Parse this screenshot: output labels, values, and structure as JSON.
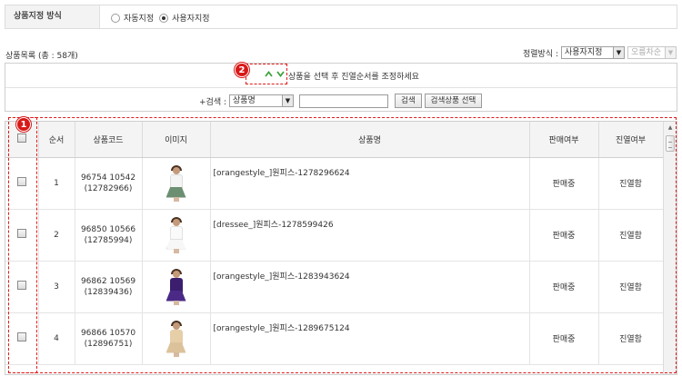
{
  "assign_method": {
    "label": "상품지정 방식",
    "options": [
      {
        "label": "자동지정",
        "checked": false
      },
      {
        "label": "사용자지정",
        "checked": true
      }
    ]
  },
  "product_list": {
    "title": "상품목록 (총 : 58개)",
    "sort_label": "정렬방식 :",
    "sort_value": "사용자지정",
    "order_value": "오름차순"
  },
  "controls": {
    "move_up_icon": "chevron-up-icon",
    "move_down_icon": "chevron-down-icon",
    "move_message": "상품을 선택 후 진열순서를 조정하세요",
    "search_label": "+검색 :",
    "search_field_value": "상품명",
    "search_input_value": "",
    "search_button": "검색",
    "select_results_button": "검색상품 선택"
  },
  "table": {
    "headers": [
      "순서",
      "상품코드",
      "이미지",
      "상품명",
      "판매여부",
      "진열여부"
    ],
    "rows": [
      {
        "order": "1",
        "code": "96754 10542",
        "code_sub": "(12782966)",
        "name": "[orangestyle_]원피스-1278296624",
        "sale": "판매중",
        "display": "진열함"
      },
      {
        "order": "2",
        "code": "96850 10566",
        "code_sub": "(12785994)",
        "name": "[dressee_]원피스-1278599426",
        "sale": "판매중",
        "display": "진열함"
      },
      {
        "order": "3",
        "code": "96862 10569",
        "code_sub": "(12839436)",
        "name": "[orangestyle_]원피스-1283943624",
        "sale": "판매중",
        "display": "진열함"
      },
      {
        "order": "4",
        "code": "96866 10570",
        "code_sub": "(12896751)",
        "name": "[orangestyle_]원피스-1289675124",
        "sale": "판매중",
        "display": "진열함"
      }
    ]
  },
  "annotations": [
    "1",
    "2"
  ],
  "colors": {
    "annotation_red": "#d81818",
    "arrow_green": "#3ea33e",
    "header_bg": "#f4f4f4"
  }
}
